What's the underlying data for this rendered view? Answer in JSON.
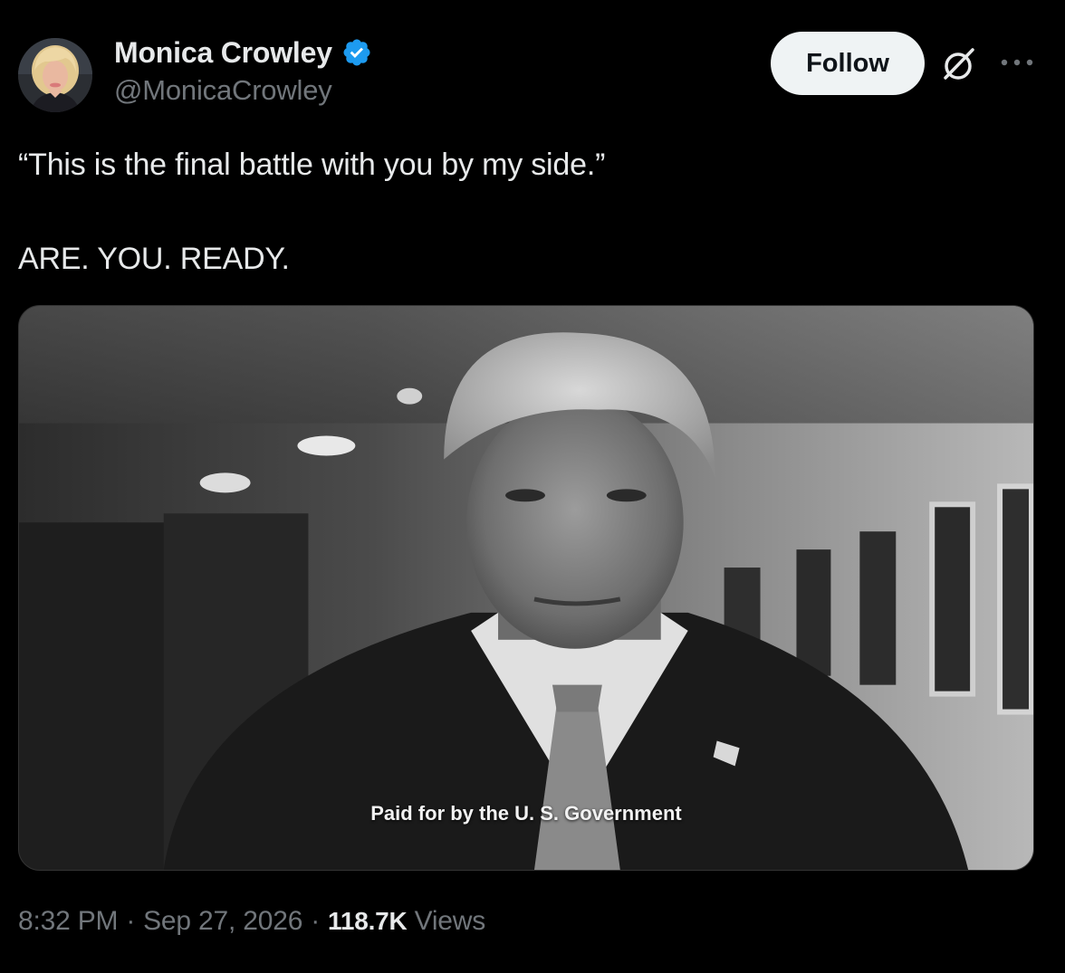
{
  "author": {
    "display_name": "Monica Crowley",
    "handle": "@MonicaCrowley",
    "verified": true
  },
  "actions": {
    "follow_label": "Follow"
  },
  "tweet": {
    "text": "“This is the final battle with you by my side.”\n\nARE. YOU. READY."
  },
  "media": {
    "caption": "Paid for by the U. S. Government"
  },
  "meta": {
    "time": "8:32 PM",
    "separator": "·",
    "date": "Sep 27, 2026",
    "views_count": "118.7K",
    "views_label": "Views"
  },
  "colors": {
    "background": "#000000",
    "text_primary": "#e7e9ea",
    "text_secondary": "#71767b",
    "verified_blue": "#1d9bf0",
    "follow_bg": "#eff3f4"
  },
  "icons": {
    "verified": "verified-badge-icon",
    "grok": "grok-icon",
    "more": "more-dots-icon"
  }
}
